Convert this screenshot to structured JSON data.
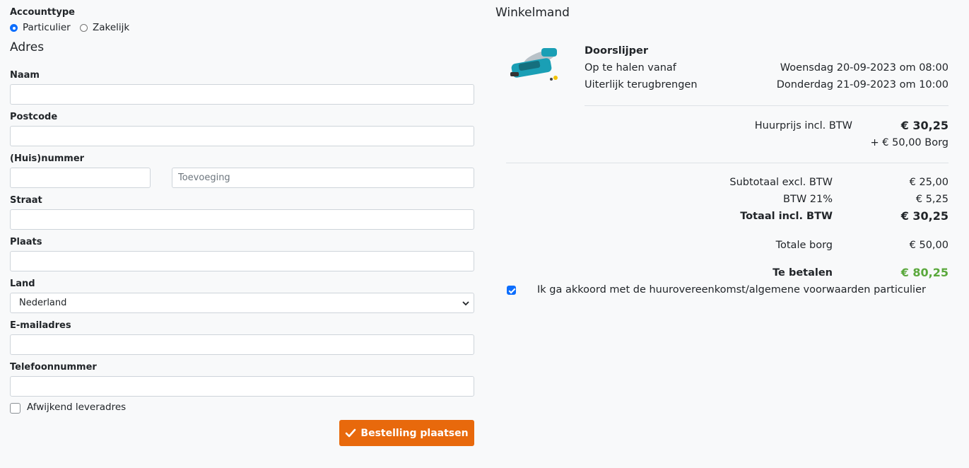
{
  "form": {
    "account_type_label": "Accounttype",
    "account_options": [
      {
        "label": "Particulier",
        "selected": true
      },
      {
        "label": "Zakelijk",
        "selected": false
      }
    ],
    "section_title": "Adres",
    "fields": {
      "naam": {
        "label": "Naam",
        "value": ""
      },
      "postcode": {
        "label": "Postcode",
        "value": ""
      },
      "huisnummer": {
        "label": "(Huis)nummer",
        "value": ""
      },
      "toevoeging": {
        "placeholder": "Toevoeging",
        "value": ""
      },
      "straat": {
        "label": "Straat",
        "value": ""
      },
      "plaats": {
        "label": "Plaats",
        "value": ""
      },
      "land": {
        "label": "Land",
        "value": "Nederland"
      },
      "email": {
        "label": "E-mailadres",
        "value": ""
      },
      "telefoon": {
        "label": "Telefoonnummer",
        "value": ""
      }
    },
    "alt_delivery": {
      "label": "Afwijkend leveradres",
      "checked": false
    },
    "submit_label": "Bestelling plaatsen"
  },
  "cart": {
    "title": "Winkelmand",
    "item": {
      "name": "Doorslijper",
      "pickup_label": "Op te halen vanaf",
      "pickup_value": "Woensdag 20-09-2023 om 08:00",
      "return_label": "Uiterlijk terugbrengen",
      "return_value": "Donderdag 21-09-2023 om 10:00",
      "price_label": "Huurprijs incl. BTW",
      "price_value": "€ 30,25",
      "deposit_text": "+ € 50,00 Borg"
    },
    "totals": {
      "subtotal_label": "Subtotaal excl. BTW",
      "subtotal_value": "€ 25,00",
      "vat_label": "BTW 21%",
      "vat_value": "€ 5,25",
      "total_label": "Totaal incl. BTW",
      "total_value": "€ 30,25",
      "deposit_label": "Totale borg",
      "deposit_value": "€ 50,00",
      "pay_label": "Te betalen",
      "pay_value": "€ 80,25"
    },
    "terms": {
      "label": "Ik ga akkoord met de huurovereenkomst/algemene voorwaarden particulier",
      "checked": true
    },
    "colors": {
      "accent": "#e8690c",
      "pay_green": "#5aa83c",
      "checkbox_blue": "#0d6efd"
    }
  }
}
